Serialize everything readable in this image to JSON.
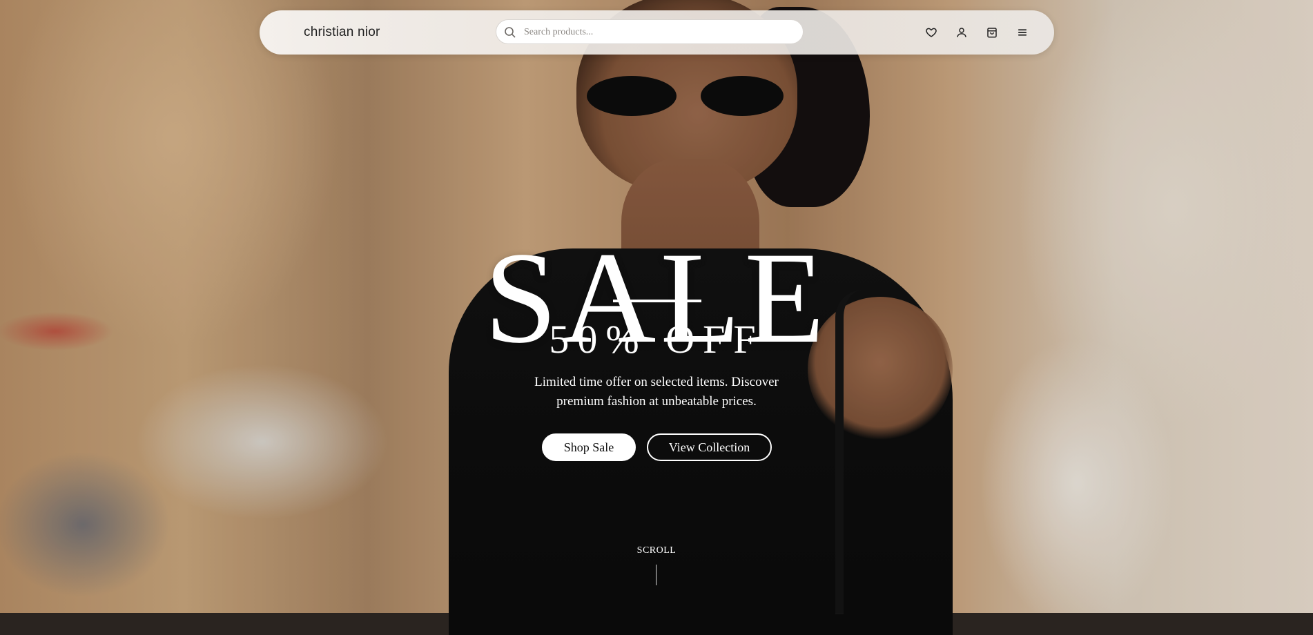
{
  "brand": {
    "name": "christian nior"
  },
  "search": {
    "placeholder": "Search products...",
    "value": ""
  },
  "nav_icons": [
    "heart-icon",
    "user-icon",
    "shopping-bag-icon",
    "menu-icon"
  ],
  "hero": {
    "title": "SALE",
    "discount": "50% OFF",
    "description": "Limited time offer on selected items. Discover premium fashion at unbeatable prices.",
    "primary_button": "Shop Sale",
    "secondary_button": "View Collection",
    "scroll_label": "SCROLL"
  },
  "colors": {
    "text_light": "#ffffff",
    "navbar_bg": "#f3f0ed",
    "brand_text": "#222222"
  }
}
